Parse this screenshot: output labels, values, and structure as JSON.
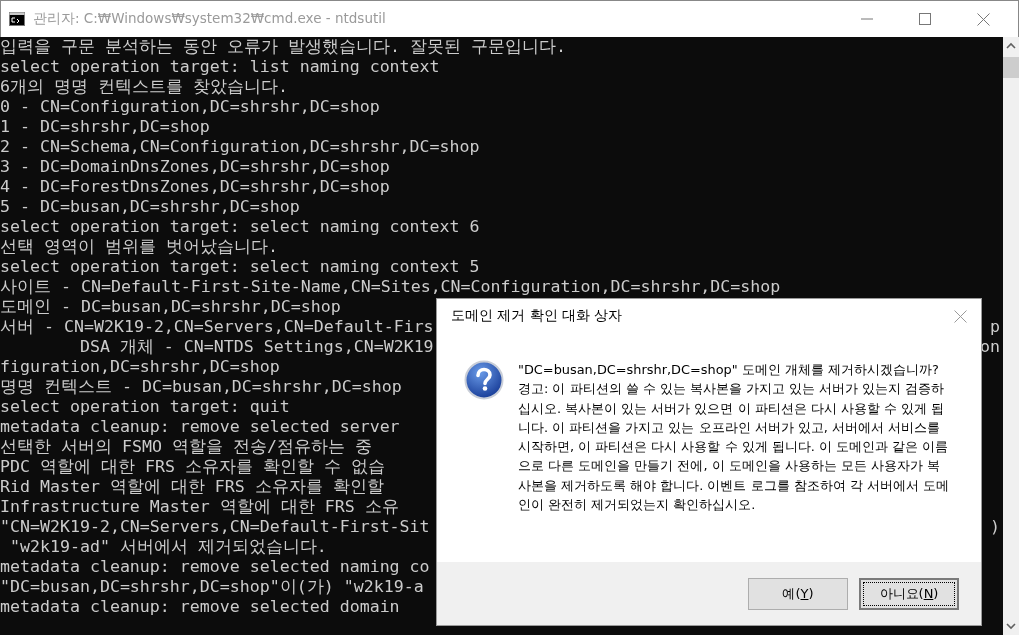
{
  "window": {
    "title": "관리자: C:₩Windows₩system32₩cmd.exe - ntdsutil"
  },
  "console": {
    "lines": [
      {
        "text": "입력을 구문 분석하는 동안 오류가 발생했습니다. 잘못된 구문입니다."
      },
      {
        "text": "select operation target: list naming context"
      },
      {
        "text": "6개의 명명 컨텍스트를 찾았습니다."
      },
      {
        "text": "0 - CN=Configuration,DC=shrshr,DC=shop"
      },
      {
        "text": "1 - DC=shrshr,DC=shop"
      },
      {
        "text": "2 - CN=Schema,CN=Configuration,DC=shrshr,DC=shop"
      },
      {
        "text": "3 - DC=DomainDnsZones,DC=shrshr,DC=shop"
      },
      {
        "text": "4 - DC=ForestDnsZones,DC=shrshr,DC=shop"
      },
      {
        "text": "5 - DC=busan,DC=shrshr,DC=shop"
      },
      {
        "text": "select operation target: select naming context 6"
      },
      {
        "text": "선택 영역이 범위를 벗어났습니다."
      },
      {
        "text": "select operation target: select naming context 5"
      },
      {
        "text": "사이트 - CN=Default-First-Site-Name,CN=Sites,CN=Configuration,DC=shrshr,DC=shop"
      },
      {
        "text": "도메인 - DC=busan,DC=shrshr,DC=shop"
      },
      {
        "text": "서버 - CN=W2K19-2,CN=Servers,CN=Default-Firs",
        "tail": "p"
      },
      {
        "text": "        DSA 개체 - CN=NTDS Settings,CN=W2K19",
        "tail": "on"
      },
      {
        "text": "figuration,DC=shrshr,DC=shop"
      },
      {
        "text": "명명 컨텍스트 - DC=busan,DC=shrshr,DC=shop"
      },
      {
        "text": "select operation target: quit"
      },
      {
        "text": "metadata cleanup: remove selected server"
      },
      {
        "text": "선택한 서버의 FSMO 역할을 전송/점유하는 중"
      },
      {
        "text": "PDC 역할에 대한 FRS 소유자를 확인할 수 없습"
      },
      {
        "text": "Rid Master 역할에 대한 FRS 소유자를 확인할"
      },
      {
        "text": "Infrastructure Master 역할에 대한 FRS 소유"
      },
      {
        "text": "\"CN=W2K19-2,CN=Servers,CN=Default-First-Sit",
        "tail": ")"
      },
      {
        "text": " \"w2k19-ad\" 서버에서 제거되었습니다."
      },
      {
        "text": "metadata cleanup: remove selected naming co"
      },
      {
        "text": "\"DC=busan,DC=shrshr,DC=shop\"이(가) \"w2k19-a"
      },
      {
        "text": "metadata cleanup: remove selected domain"
      }
    ]
  },
  "dialog": {
    "title": "도메인 제거 확인 대화 상자",
    "question": "\"DC=busan,DC=shrshr,DC=shop\" 도메인 개체를 제거하시겠습니까?",
    "warning": "경고: 이 파티션의 쓸 수 있는 복사본을 가지고 있는 서버가 있는지 검증하십시오. 복사본이 있는 서버가 있으면 이 파티션은 다시 사용할 수 있게 됩니다. 이 파티션을 가지고 있는 오프라인 서버가 있고, 서버에서 서비스를 시작하면, 이 파티션은 다시 사용할 수 있게 됩니다. 이 도메인과 같은 이름으로 다른 도메인을 만들기 전에, 이 도메인을 사용하는 모든 사용자가 복사본을 제거하도록 해야 합니다. 이벤트 로그를 참조하여 각 서버에서 도메인이 완전히 제거되었는지 확인하십시오.",
    "buttons": [
      {
        "label": "예(",
        "access_key": "Y",
        "label_end": ")",
        "focused": false
      },
      {
        "label": "아니요(",
        "access_key": "N",
        "label_end": ")",
        "focused": true
      }
    ]
  }
}
